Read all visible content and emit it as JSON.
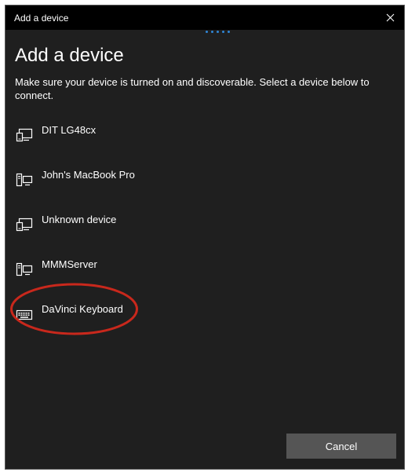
{
  "window": {
    "title": "Add a device",
    "close_icon": "close-icon"
  },
  "main": {
    "heading": "Add a device",
    "instruction": "Make sure your device is turned on and discoverable. Select a device below to connect."
  },
  "devices": [
    {
      "label": "DIT LG48cx",
      "icon": "display-device-icon"
    },
    {
      "label": "John's MacBook Pro",
      "icon": "computer-device-icon"
    },
    {
      "label": "Unknown device",
      "icon": "display-device-icon"
    },
    {
      "label": "MMMServer",
      "icon": "computer-device-icon"
    },
    {
      "label": "DaVinci Keyboard",
      "icon": "keyboard-icon"
    }
  ],
  "footer": {
    "cancel_label": "Cancel"
  },
  "colors": {
    "background": "#1f1f1f",
    "titlebar": "#000000",
    "accent_dots": "#2f86d6",
    "button": "#555555",
    "highlight_ellipse": "#c8281c"
  }
}
